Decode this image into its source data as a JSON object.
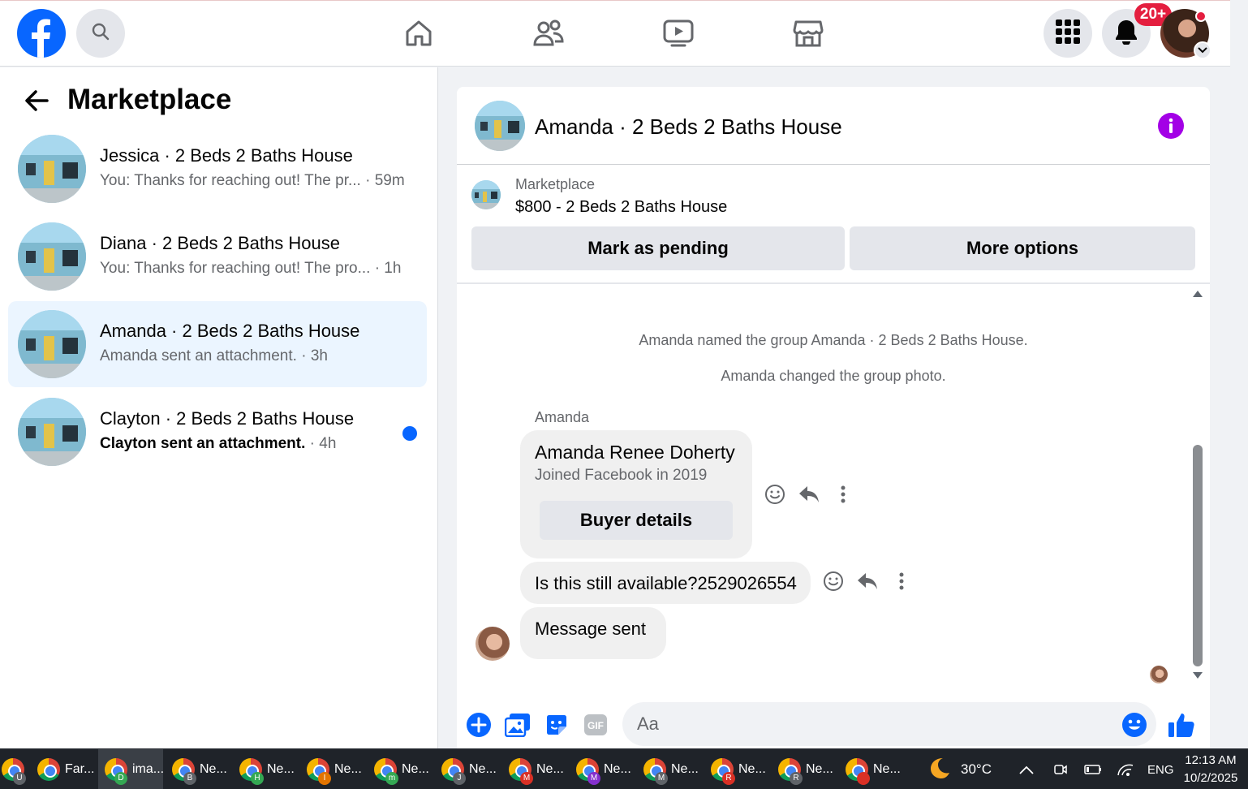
{
  "header": {
    "search_icon": "search-icon",
    "notifications_badge": "20+",
    "nav": [
      "home-icon",
      "friends-icon",
      "video-icon",
      "marketplace-icon"
    ]
  },
  "left": {
    "title": "Marketplace",
    "conversations": [
      {
        "name": "Jessica · 2 Beds 2 Baths House",
        "snippet": "You: Thanks for reaching out! The pr...",
        "time": " · 59m",
        "unread": false,
        "active": false
      },
      {
        "name": "Diana · 2 Beds 2 Baths House",
        "snippet": "You: Thanks for reaching out! The pro...",
        "time": " · 1h",
        "unread": false,
        "active": false
      },
      {
        "name": "Amanda · 2 Beds 2 Baths House",
        "snippet": "Amanda sent an attachment.",
        "time": " · 3h",
        "unread": false,
        "active": true
      },
      {
        "name": "Clayton · 2 Beds 2 Baths House",
        "snippet": "Clayton sent an attachment.",
        "time": " · 4h",
        "unread": true,
        "active": false
      }
    ]
  },
  "chat": {
    "title": "Amanda · 2 Beds 2 Baths House",
    "listing": {
      "source": "Marketplace",
      "price_title": "$800 - 2 Beds 2 Baths House",
      "mark_pending": "Mark as pending",
      "more_options": "More options"
    },
    "system_messages": [
      "Amanda named the group Amanda · 2 Beds 2 Baths House.",
      "Amanda changed the group photo."
    ],
    "sender": "Amanda",
    "card": {
      "name": "Amanda Renee Doherty",
      "joined": "Joined Facebook in 2019",
      "button": "Buyer details"
    },
    "message": "Is this still available?2529026554",
    "reply": "Message sent",
    "composer_placeholder": "Aa"
  },
  "taskbar": {
    "items": [
      {
        "label": "",
        "badge": "U",
        "badge_color": "#5f6368"
      },
      {
        "label": "Far...",
        "badge": "",
        "badge_color": "#5f6368"
      },
      {
        "label": "ima...",
        "badge": "D",
        "badge_color": "#34a853"
      },
      {
        "label": "Ne...",
        "badge": "B",
        "badge_color": "#5f6368"
      },
      {
        "label": "Ne...",
        "badge": "H",
        "badge_color": "#34a853"
      },
      {
        "label": "Ne...",
        "badge": "I",
        "badge_color": "#e37400"
      },
      {
        "label": "Ne...",
        "badge": "m",
        "badge_color": "#34a853"
      },
      {
        "label": "Ne...",
        "badge": "J",
        "badge_color": "#5f6368"
      },
      {
        "label": "Ne...",
        "badge": "M",
        "badge_color": "#d93025"
      },
      {
        "label": "Ne...",
        "badge": "M",
        "badge_color": "#8430ce"
      },
      {
        "label": "Ne...",
        "badge": "M",
        "badge_color": "#5f6368"
      },
      {
        "label": "Ne...",
        "badge": "R",
        "badge_color": "#d93025"
      },
      {
        "label": "Ne...",
        "badge": "R",
        "badge_color": "#5f6368"
      },
      {
        "label": "Ne...",
        "badge": "",
        "badge_color": "#d93025"
      }
    ],
    "weather": "30°C",
    "language": "ENG",
    "time": "12:13 AM",
    "date": "10/2/2025"
  },
  "colors": {
    "brand_blue": "#0866ff",
    "info_purple": "#a300e6",
    "badge_red": "#e41e3f"
  }
}
